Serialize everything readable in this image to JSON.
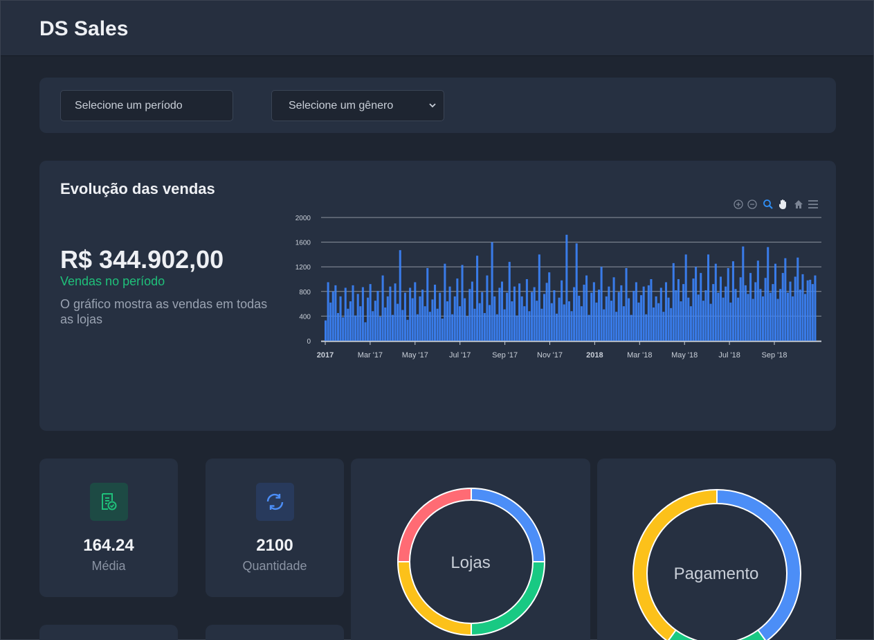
{
  "header": {
    "title": "DS Sales"
  },
  "filters": {
    "period_placeholder": "Selecione um período",
    "genre_selected": "Selecione um gênero"
  },
  "sales": {
    "title": "Evolução das vendas",
    "total": "R$ 344.902,00",
    "subtitle": "Vendas no período",
    "description": "O gráfico mostra as vendas em todas as lojas"
  },
  "chart_toolbar": {
    "icons": [
      "zoom-in-icon",
      "zoom-out-icon",
      "selection-zoom-icon",
      "pan-icon",
      "reset-home-icon",
      "menu-icon"
    ]
  },
  "chart_data": {
    "type": "bar",
    "ylim": [
      0,
      2000
    ],
    "y_ticks": [
      "0",
      "400",
      "800",
      "1200",
      "1600",
      "2000"
    ],
    "x_ticks": [
      "2017",
      "Mar '17",
      "May '17",
      "Jul '17",
      "Sep '17",
      "Nov '17",
      "2018",
      "Mar '18",
      "May '18",
      "Jul '18",
      "Sep '18"
    ],
    "x_range": [
      "2017-01-01",
      "2018-11-30"
    ],
    "bar_color": "#3b82f6",
    "note_series": "daily sales values",
    "series": [
      {
        "values": [
          330,
          950,
          620,
          800,
          900,
          450,
          720,
          380,
          860,
          520,
          640,
          900,
          410,
          760,
          560,
          870,
          300,
          700,
          920,
          480,
          650,
          810,
          390,
          1060,
          540,
          720,
          880,
          420,
          930,
          600,
          1470,
          500,
          780,
          340,
          860,
          690,
          950,
          430,
          720,
          830,
          560,
          1180,
          470,
          670,
          910,
          520,
          780,
          360,
          1250,
          640,
          880,
          430,
          720,
          1010,
          560,
          1230,
          690,
          400,
          840,
          960,
          520,
          1380,
          610,
          790,
          450,
          1060,
          580,
          1600,
          720,
          430,
          860,
          960,
          510,
          780,
          1280,
          640,
          880,
          410,
          930,
          720,
          560,
          1000,
          480,
          790,
          870,
          650,
          1400,
          520,
          760,
          940,
          1110,
          610,
          820,
          440,
          700,
          980,
          590,
          1720,
          640,
          480,
          870,
          1580,
          730,
          560,
          910,
          1060,
          420,
          780,
          950,
          620,
          830,
          1200,
          510,
          720,
          880,
          650,
          1030,
          470,
          790,
          900,
          560,
          1180,
          690,
          420,
          810,
          950,
          620,
          740,
          880,
          430,
          900,
          1000,
          540,
          720,
          610,
          860,
          470,
          950,
          700,
          530,
          1260,
          820,
          1000,
          640,
          920,
          1400,
          700,
          560,
          1010,
          1200,
          750,
          1100,
          650,
          820,
          1400,
          600,
          920,
          1250,
          780,
          1040,
          700,
          880,
          1180,
          620,
          1290,
          840,
          700,
          1030,
          1530,
          900,
          760,
          1100,
          680,
          950,
          1300,
          840,
          720,
          1020,
          1520,
          780,
          920,
          1250,
          680,
          840,
          1100,
          1340,
          780,
          960,
          720,
          1040,
          1350,
          830,
          1080,
          760,
          980,
          990,
          920,
          1060
        ]
      }
    ]
  },
  "stats": {
    "average": {
      "value": "164.24",
      "label": "Média",
      "icon": "receipt-check-icon",
      "color": "#1fc07a"
    },
    "quantity": {
      "value": "2100",
      "label": "Quantidade",
      "icon": "refresh-icon",
      "color": "#4c8ef7"
    }
  },
  "donuts": {
    "stores": {
      "label": "Lojas",
      "segments": [
        {
          "value": 25,
          "color": "#4c8ef7"
        },
        {
          "value": 25,
          "color": "#19c983"
        },
        {
          "value": 25,
          "color": "#fcc11a"
        },
        {
          "value": 25,
          "color": "#ff6b74"
        }
      ]
    },
    "payment": {
      "label": "Pagamento",
      "segments": [
        {
          "value": 40,
          "color": "#4c8ef7"
        },
        {
          "value": 20,
          "color": "#19c983"
        },
        {
          "value": 40,
          "color": "#fcc11a"
        }
      ]
    }
  }
}
